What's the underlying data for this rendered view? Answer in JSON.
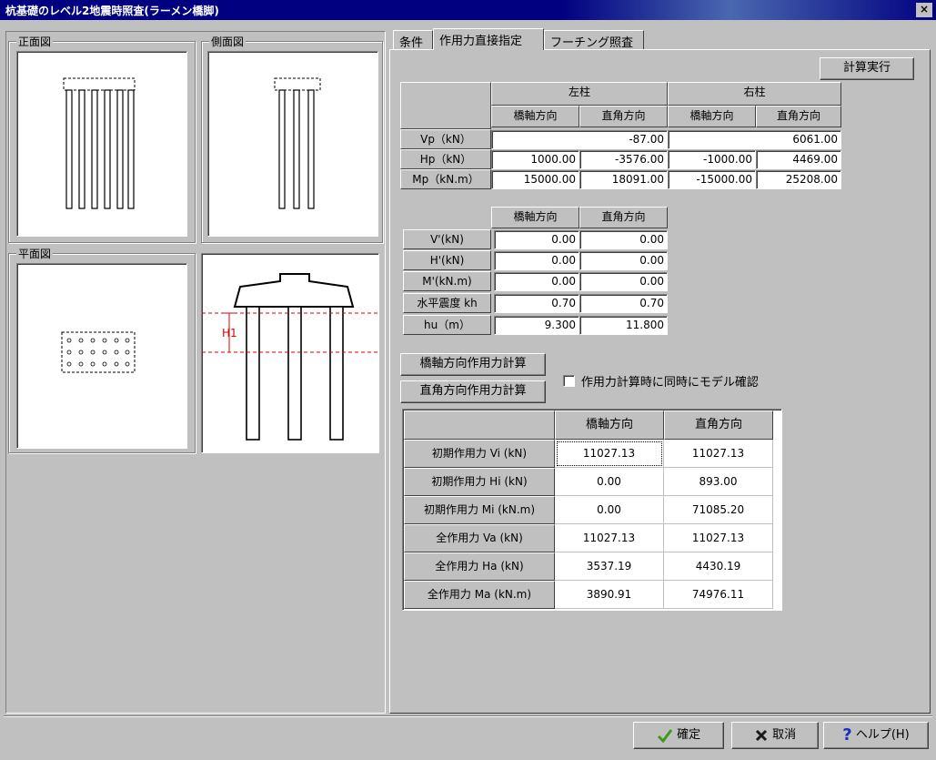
{
  "window": {
    "title": "杭基礎のレベル2地震時照査(ラーメン橋脚)",
    "close_label": "×"
  },
  "left": {
    "front_view_label": "正面図",
    "side_view_label": "側面図",
    "plan_view_label": "平面図",
    "h1_label": "H1"
  },
  "tabs": [
    {
      "label": "条件"
    },
    {
      "label": "作用力直接指定"
    },
    {
      "label": "フーチング照査"
    }
  ],
  "buttons": {
    "calculate": "計算実行",
    "bridge_axis_calc": "橋軸方向作用力計算",
    "perpendicular_calc": "直角方向作用力計算",
    "ok": "確定",
    "cancel": "取消",
    "help": "ヘルプ(H)"
  },
  "checkbox": {
    "label": "作用力計算時に同時にモデル確認",
    "checked": false
  },
  "table1": {
    "group_headers": [
      "左柱",
      "右柱"
    ],
    "sub_headers": [
      "橋軸方向",
      "直角方向",
      "橋軸方向",
      "直角方向"
    ],
    "rows": [
      {
        "label": "Vp（kN）",
        "left_merged": "-87.00",
        "right_merged": "6061.00"
      },
      {
        "label": "Hp（kN）",
        "values": [
          "1000.00",
          "-3576.00",
          "-1000.00",
          "4469.00"
        ]
      },
      {
        "label": "Mp（kN.m）",
        "values": [
          "15000.00",
          "18091.00",
          "-15000.00",
          "25208.00"
        ]
      }
    ]
  },
  "table2": {
    "headers": [
      "橋軸方向",
      "直角方向"
    ],
    "rows": [
      {
        "label": "V'(kN)",
        "values": [
          "0.00",
          "0.00"
        ]
      },
      {
        "label": "H'(kN)",
        "values": [
          "0.00",
          "0.00"
        ]
      },
      {
        "label": "M'(kN.m)",
        "values": [
          "0.00",
          "0.00"
        ]
      },
      {
        "label": "水平震度 kh",
        "values": [
          "0.70",
          "0.70"
        ]
      },
      {
        "label": "hu（m）",
        "values": [
          "9.300",
          "11.800"
        ]
      }
    ]
  },
  "table3": {
    "headers": [
      "橋軸方向",
      "直角方向"
    ],
    "rows": [
      {
        "label": "初期作用力 Vi (kN)",
        "values": [
          "11027.13",
          "11027.13"
        ]
      },
      {
        "label": "初期作用力 Hi (kN)",
        "values": [
          "0.00",
          "893.00"
        ]
      },
      {
        "label": "初期作用力 Mi (kN.m)",
        "values": [
          "0.00",
          "71085.20"
        ]
      },
      {
        "label": "全作用力 Va (kN)",
        "values": [
          "11027.13",
          "11027.13"
        ]
      },
      {
        "label": "全作用力 Ha (kN)",
        "values": [
          "3537.19",
          "4430.19"
        ]
      },
      {
        "label": "全作用力 Ma (kN.m)",
        "values": [
          "3890.91",
          "74976.11"
        ]
      }
    ]
  },
  "colors": {
    "window_bg": "#c0c0c0",
    "title_bg": "#000080",
    "guide_red": "#e00000",
    "ok_check": "#3a9a1a",
    "cancel_x": "#1a1a1a",
    "help_icon": "#1a2fc0"
  },
  "icons": {
    "ok": "check-icon",
    "cancel": "x-icon",
    "help": "question-icon"
  }
}
